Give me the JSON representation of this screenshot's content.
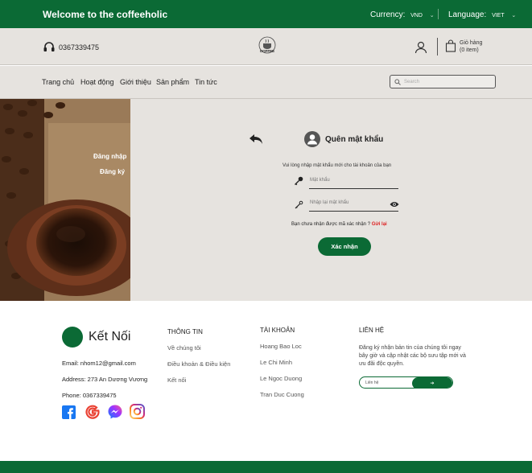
{
  "topbar": {
    "welcome": "Welcome to the coffeeholic",
    "currency_label": "Currency:",
    "currency_value": "VND",
    "language_label": "Language:",
    "language_value": "VIET"
  },
  "header": {
    "phone": "0367339475",
    "logo_text": "COFFEE",
    "cart_label": "Giỏ hàng",
    "cart_count": "(0 item)"
  },
  "nav": {
    "items": [
      {
        "label": "Trang chủ"
      },
      {
        "label": "Hoạt động"
      },
      {
        "label": "Giới thiệu"
      },
      {
        "label": "Sản phẩm"
      },
      {
        "label": "Tin tức"
      }
    ],
    "search_placeholder": "Search"
  },
  "hero": {
    "login": "Đăng nhập",
    "register": "Đăng ký"
  },
  "form": {
    "title": "Quên mật khẩu",
    "description": "Vui lòng nhập mật khẩu mới cho  tài khoản của bạn",
    "password_placeholder": "Mật khẩu",
    "confirm_placeholder": "Nhập lại mật khẩu",
    "resend_text": "Bạn chưa nhận được mã xác nhận ?",
    "resend_link": "Gửi lại",
    "submit_label": "Xác nhận"
  },
  "footer": {
    "brand": "Kết Nối",
    "email": "Email: nhom12@gmail.com",
    "address": "Address: 273 An Dương Vương",
    "phone": "Phone: 0367339475",
    "col1": {
      "title": "THÔNG TIN",
      "items": [
        "Về chúng tôi",
        "Điều khoản & Điều kiện",
        "Kết nối"
      ]
    },
    "col2": {
      "title": "TÀI KHOẢN",
      "items": [
        "Hoang Bao Loc",
        "Le Chi Minh",
        "Le Ngoc Duong",
        "Tran Duc Cuong"
      ]
    },
    "col3": {
      "title": "LIÊN HỆ",
      "description": "Đăng ký nhận bản tin của chúng tôi ngay bây giờ và cập nhật các bộ sưu tập mới và ưu đãi độc quyền.",
      "input_placeholder": "Liên hệ",
      "button_label": "➔"
    },
    "socials": [
      "facebook-icon",
      "google-icon",
      "messenger-icon",
      "instagram-icon"
    ]
  },
  "colors": {
    "brand_green": "#0b6a35",
    "panel_bg": "#e6e3df",
    "link_red": "#d22222"
  }
}
